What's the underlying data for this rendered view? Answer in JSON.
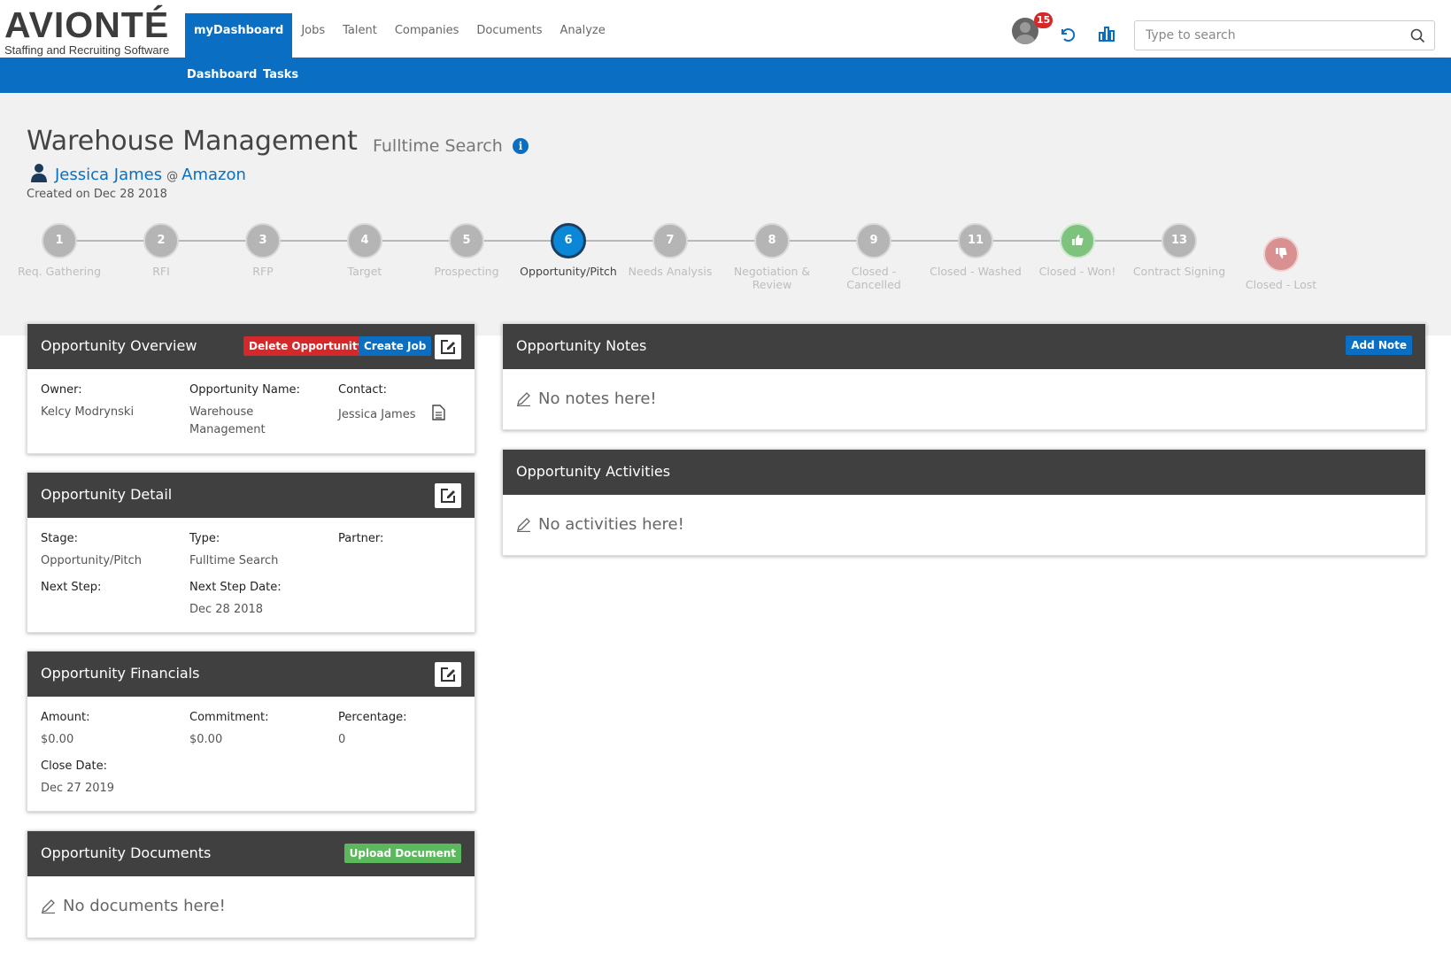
{
  "logo": {
    "word": "AVIONTÉ",
    "tagline": "Staffing and Recruiting Software"
  },
  "nav": {
    "items": [
      "myDashboard",
      "Jobs",
      "Talent",
      "Companies",
      "Documents",
      "Analyze"
    ],
    "active": "myDashboard"
  },
  "notifications": {
    "count": "15"
  },
  "search": {
    "placeholder": "Type to search"
  },
  "subnav": {
    "items": [
      "Dashboard",
      "Tasks"
    ]
  },
  "opportunity": {
    "title": "Warehouse Management",
    "type": "Fulltime Search",
    "contact_name": "Jessica James",
    "at": "@",
    "company": "Amazon",
    "created": "Created on Dec 28 2018"
  },
  "stages": [
    {
      "num": "1",
      "label": "Req. Gathering",
      "state": "normal"
    },
    {
      "num": "2",
      "label": "RFI",
      "state": "normal"
    },
    {
      "num": "3",
      "label": "RFP",
      "state": "normal"
    },
    {
      "num": "4",
      "label": "Target",
      "state": "normal"
    },
    {
      "num": "5",
      "label": "Prospecting",
      "state": "normal"
    },
    {
      "num": "6",
      "label": "Opportunity/Pitch",
      "state": "active"
    },
    {
      "num": "7",
      "label": "Needs Analysis",
      "state": "normal"
    },
    {
      "num": "8",
      "label": "Negotiation & Review",
      "state": "normal"
    },
    {
      "num": "9",
      "label": "Closed - Cancelled",
      "state": "normal"
    },
    {
      "num": "11",
      "label": "Closed - Washed",
      "state": "normal"
    },
    {
      "num": "",
      "label": "Closed - Won!",
      "state": "won"
    },
    {
      "num": "13",
      "label": "Contract Signing",
      "state": "normal"
    },
    {
      "num": "",
      "label": "Closed - Lost",
      "state": "lost"
    }
  ],
  "overview": {
    "title": "Opportunity Overview",
    "delete_label": "Delete Opportunity",
    "create_job_label": "Create Job",
    "owner_label": "Owner:",
    "owner": "Kelcy Modrynski",
    "name_label": "Opportunity Name:",
    "name": "Warehouse Management",
    "contact_label": "Contact:",
    "contact": "Jessica James"
  },
  "detail": {
    "title": "Opportunity Detail",
    "stage_label": "Stage:",
    "stage": "Opportunity/Pitch",
    "type_label": "Type:",
    "type": "Fulltime Search",
    "partner_label": "Partner:",
    "partner": "",
    "next_step_label": "Next Step:",
    "next_step": "",
    "next_step_date_label": "Next Step Date:",
    "next_step_date": "Dec 28 2018"
  },
  "financials": {
    "title": "Opportunity Financials",
    "amount_label": "Amount:",
    "amount": "$0.00",
    "commitment_label": "Commitment:",
    "commitment": "$0.00",
    "percentage_label": "Percentage:",
    "percentage": "0",
    "close_date_label": "Close Date:",
    "close_date": "Dec 27 2019"
  },
  "documents": {
    "title": "Opportunity Documents",
    "upload_label": "Upload Document",
    "empty": "No documents here!"
  },
  "notes": {
    "title": "Opportunity Notes",
    "add_label": "Add Note",
    "empty": "No notes here!"
  },
  "activities": {
    "title": "Opportunity Activities",
    "empty": "No activities here!"
  },
  "colors": {
    "brand_blue": "#0a6fc2",
    "active_step": "#0a87d6",
    "won": "#7dc27d",
    "lost": "#d99090",
    "danger": "#d62828",
    "success": "#5cb85c",
    "card_header": "#404040"
  }
}
